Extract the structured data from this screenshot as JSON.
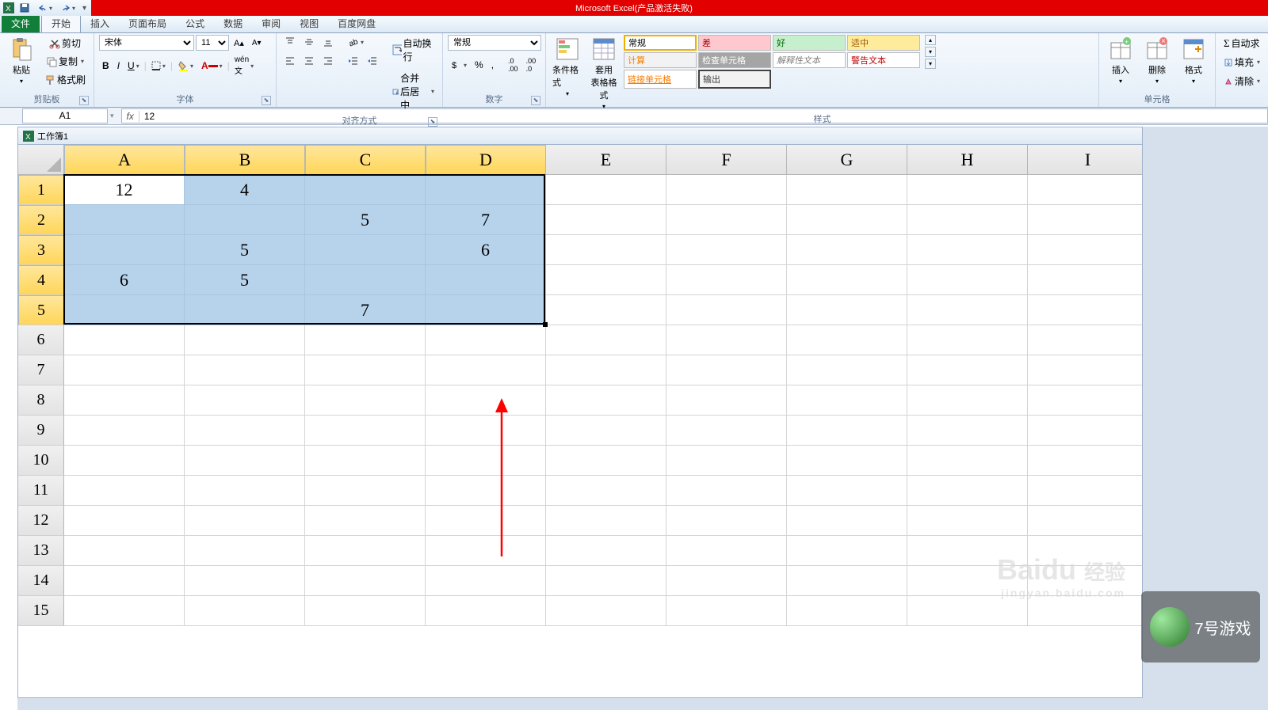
{
  "app": {
    "title": "Microsoft Excel(产品激活失败)"
  },
  "qat": {
    "save_icon": "save",
    "undo_icon": "undo",
    "redo_icon": "redo"
  },
  "tabs": {
    "file": "文件",
    "home": "开始",
    "insert": "插入",
    "page_layout": "页面布局",
    "formulas": "公式",
    "data": "数据",
    "review": "审阅",
    "view": "视图",
    "baidu": "百度网盘"
  },
  "ribbon": {
    "clipboard": {
      "paste": "粘贴",
      "cut": "剪切",
      "copy": "复制",
      "format_painter": "格式刷",
      "label": "剪贴板"
    },
    "font": {
      "name": "宋体",
      "size": "11",
      "label": "字体"
    },
    "alignment": {
      "wrap": "自动换行",
      "merge": "合并后居中",
      "label": "对齐方式"
    },
    "number": {
      "format": "常规",
      "label": "数字"
    },
    "styles": {
      "cond_format": "条件格式",
      "table_format": "套用\n表格格式",
      "normal": "常规",
      "bad": "差",
      "good": "好",
      "neutral": "适中",
      "calc": "计算",
      "check_cell": "检查单元格",
      "explanatory": "解释性文本",
      "warning": "警告文本",
      "link": "链接单元格",
      "output": "输出",
      "label": "样式"
    },
    "cells": {
      "insert": "插入",
      "delete": "删除",
      "format": "格式",
      "label": "单元格"
    },
    "editing": {
      "autosum": "自动求",
      "fill": "填充",
      "clear": "清除"
    }
  },
  "formula_bar": {
    "name_box": "A1",
    "fx": "fx",
    "value": "12"
  },
  "workbook": {
    "name": "工作簿1"
  },
  "grid": {
    "columns": [
      "A",
      "B",
      "C",
      "D",
      "E",
      "F",
      "G",
      "H",
      "I"
    ],
    "rows": [
      "1",
      "2",
      "3",
      "4",
      "5",
      "6",
      "7",
      "8",
      "9",
      "10",
      "11",
      "12",
      "13",
      "14",
      "15"
    ],
    "selected_cols": 4,
    "selected_rows": 5,
    "data": [
      [
        "12",
        "4",
        "",
        "",
        "",
        "",
        "",
        "",
        ""
      ],
      [
        "",
        "",
        "5",
        "7",
        "",
        "",
        "",
        "",
        ""
      ],
      [
        "",
        "5",
        "",
        "6",
        "",
        "",
        "",
        "",
        ""
      ],
      [
        "6",
        "5",
        "",
        "",
        "",
        "",
        "",
        "",
        ""
      ],
      [
        "",
        "",
        "7",
        "",
        "",
        "",
        "",
        "",
        ""
      ],
      [
        "",
        "",
        "",
        "",
        "",
        "",
        "",
        "",
        ""
      ],
      [
        "",
        "",
        "",
        "",
        "",
        "",
        "",
        "",
        ""
      ],
      [
        "",
        "",
        "",
        "",
        "",
        "",
        "",
        "",
        ""
      ],
      [
        "",
        "",
        "",
        "",
        "",
        "",
        "",
        "",
        ""
      ],
      [
        "",
        "",
        "",
        "",
        "",
        "",
        "",
        "",
        ""
      ],
      [
        "",
        "",
        "",
        "",
        "",
        "",
        "",
        "",
        ""
      ],
      [
        "",
        "",
        "",
        "",
        "",
        "",
        "",
        "",
        ""
      ],
      [
        "",
        "",
        "",
        "",
        "",
        "",
        "",
        "",
        ""
      ],
      [
        "",
        "",
        "",
        "",
        "",
        "",
        "",
        "",
        ""
      ],
      [
        "",
        "",
        "",
        "",
        "",
        "",
        "",
        "",
        ""
      ]
    ]
  },
  "watermark": {
    "baidu": "Baidu",
    "jingyan": "经验",
    "url": "jingyan.baidu.com",
    "game": "7号游戏"
  }
}
